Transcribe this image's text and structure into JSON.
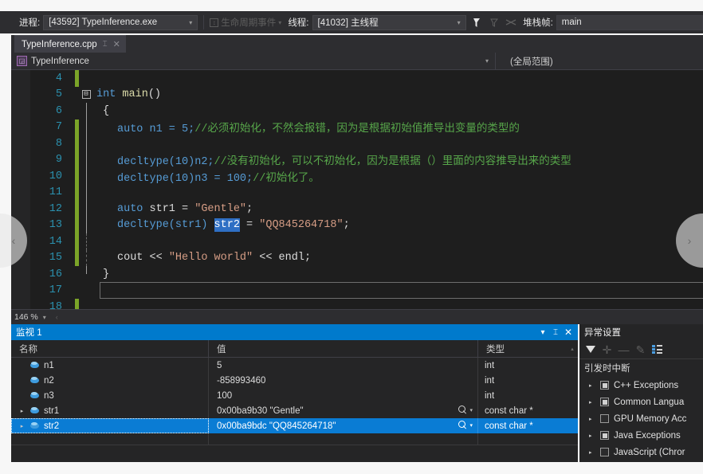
{
  "toolbar": {
    "process_label": "进程:",
    "process_value": "[43592] TypeInference.exe",
    "lifecycle_label": "生命周期事件",
    "thread_label": "线程:",
    "thread_value": "[41032] 主线程",
    "stackframe_label": "堆栈帧:",
    "stackframe_value": "main",
    "arrow_glyph": "▾",
    "lifecycle_box_glyph": "↕"
  },
  "tabstrip": {
    "filename": "TypeInference.cpp",
    "pin_glyph": "⌶",
    "close_glyph": "✕"
  },
  "navbar": {
    "project_scope": "TypeInference",
    "member_scope": "(全局范围)",
    "arrow_glyph": "▾",
    "icon_glyph": "◲"
  },
  "editor": {
    "zoom_level": "146 %",
    "zoom_arrow": "▾",
    "fold_glyph": "⊟",
    "lines": [
      {
        "num": "4",
        "changed": true,
        "text": ""
      },
      {
        "num": "5",
        "changed": false,
        "text": "int main()"
      },
      {
        "num": "6",
        "changed": false,
        "text": "{"
      },
      {
        "num": "7",
        "changed": true,
        "code": "auto n1 = 5;",
        "comment": "//必须初始化，不然会报错，因为是根据初始值推导出变量的类型的"
      },
      {
        "num": "8",
        "changed": true,
        "text": ""
      },
      {
        "num": "9",
        "changed": true,
        "code": "decltype(10)n2;",
        "comment": "//没有初始化，可以不初始化，因为是根据（）里面的内容推导出来的类型"
      },
      {
        "num": "10",
        "changed": true,
        "code": "decltype(10)n3 = 100;",
        "comment": "//初始化了。"
      },
      {
        "num": "11",
        "changed": true,
        "text": ""
      },
      {
        "num": "12",
        "changed": true,
        "code": "auto str1 = \"Gentle\";",
        "comment": ""
      },
      {
        "num": "13",
        "changed": true,
        "code": "decltype(str1) str2 = \"QQ845264718\";",
        "comment": ""
      },
      {
        "num": "14",
        "changed": true,
        "text": ""
      },
      {
        "num": "15",
        "changed": true,
        "code": "cout << \"Hello world\" << endl;",
        "comment": ""
      },
      {
        "num": "16",
        "changed": false,
        "text": "}"
      },
      {
        "num": "17",
        "changed": false,
        "text": ""
      },
      {
        "num": "18",
        "changed": true,
        "text": ""
      }
    ],
    "line13_parts": {
      "decl": "decltype(str1) ",
      "selected_token": "str2",
      "rest_op": " = ",
      "rest_str": "\"QQ845264718\"",
      "semi": ";"
    },
    "line12_parts": {
      "kw": "auto",
      "name": " str1 = ",
      "str": "\"Gentle\"",
      "semi": ";"
    },
    "line15_parts": {
      "cout": "cout",
      "op1": " << ",
      "str": "\"Hello world\"",
      "op2": " << ",
      "endl": "endl",
      "semi": ";"
    },
    "line5_parts": {
      "kw": "int",
      "name": " main",
      "parens": "()"
    }
  },
  "watch": {
    "title": "监视 1",
    "dropdown_glyph": "▾",
    "pin_glyph": "⌶",
    "close_glyph": "✕",
    "columns": [
      "名称",
      "值",
      "类型"
    ],
    "scroll_up_glyph": "▴",
    "expander_glyph": "▸",
    "rows": [
      {
        "expandable": false,
        "name": "n1",
        "value": "5",
        "type": "int",
        "magnifier": false,
        "selected": false
      },
      {
        "expandable": false,
        "name": "n2",
        "value": "-858993460",
        "type": "int",
        "magnifier": false,
        "selected": false
      },
      {
        "expandable": false,
        "name": "n3",
        "value": "100",
        "type": "int",
        "magnifier": false,
        "selected": false
      },
      {
        "expandable": true,
        "name": "str1",
        "value": "0x00ba9b30 \"Gentle\"",
        "type": "const char *",
        "magnifier": true,
        "selected": false
      },
      {
        "expandable": true,
        "name": "str2",
        "value": "0x00ba9bdc \"QQ845264718\"",
        "type": "const char *",
        "magnifier": true,
        "selected": true
      }
    ]
  },
  "exceptions": {
    "title": "异常设置",
    "toolbar_icons": [
      "funnel-icon",
      "add-icon",
      "remove-icon",
      "edit-icon",
      "list-icon"
    ],
    "add_glyph": "✛",
    "remove_glyph": "—",
    "edit_glyph": "✎",
    "section_label": "引发时中断",
    "expander_glyph": "▸",
    "items": [
      {
        "label": "C++ Exceptions",
        "checked": true
      },
      {
        "label": "Common Langua",
        "checked": true
      },
      {
        "label": "GPU Memory Acc",
        "checked": false
      },
      {
        "label": "Java Exceptions",
        "checked": true
      },
      {
        "label": "JavaScript (Chror",
        "checked": false
      }
    ]
  },
  "edge_nav": {
    "left_glyph": "‹",
    "right_glyph": "›"
  },
  "colors": {
    "accent_blue": "#007acc",
    "selection_blue": "#0a7cd4",
    "editor_bg": "#1e1e1e",
    "chrome_bg": "#2d2d30",
    "panel_bg": "#252526",
    "line_number": "#2b91af",
    "comment_green": "#57a64a",
    "string_orange": "#d69d85",
    "keyword_blue": "#569cd6",
    "changebar_green": "#7ba428"
  }
}
